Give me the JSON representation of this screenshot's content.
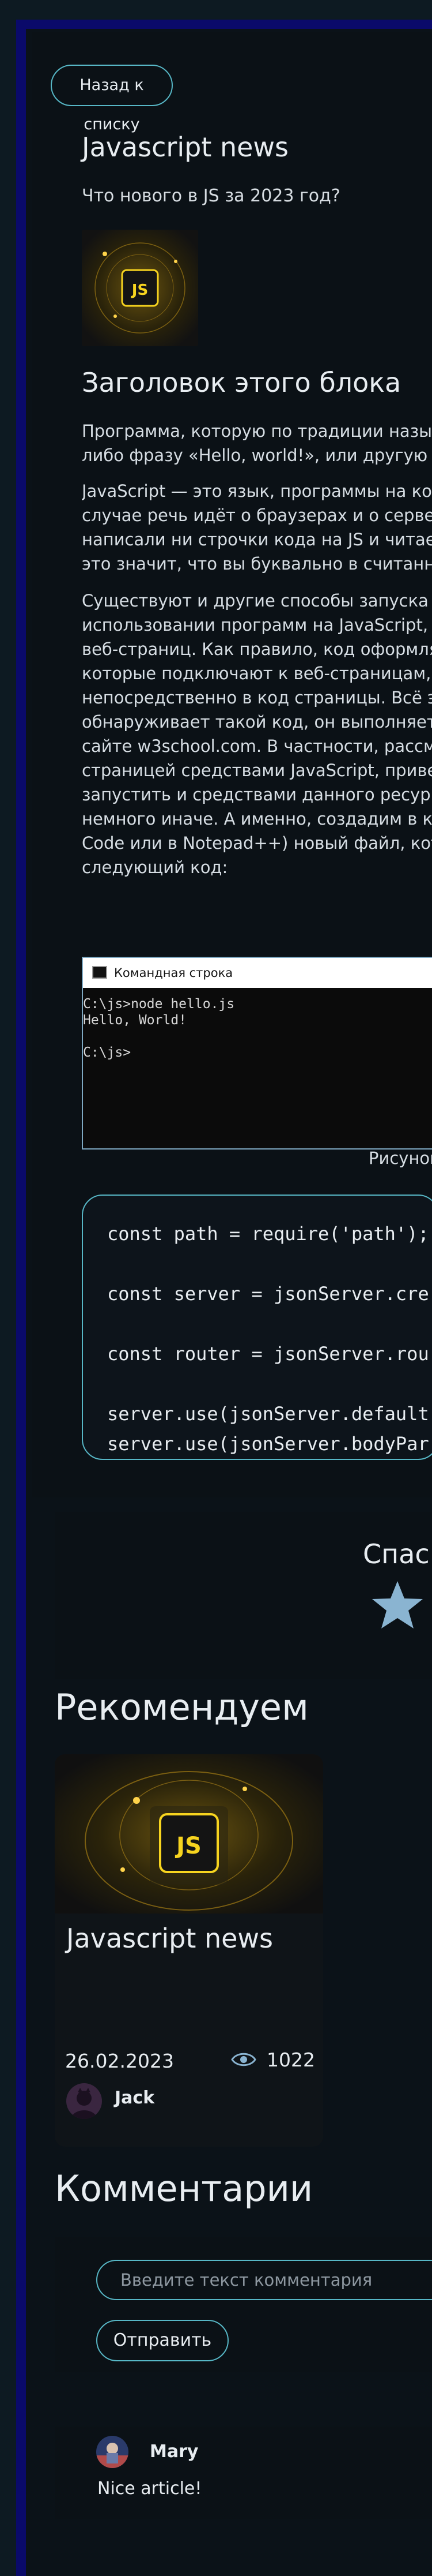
{
  "article": {
    "back_button": "Назад к списку",
    "title": "Javascript news",
    "subtitle": "Что нового в JS за 2023 год?",
    "thumbnail_icon": "js-logo-icon",
    "block_title": "Заголовок этого блока",
    "paragraphs": [
      [
        "Программа, которую по традиции назы",
        "либо фразу «Hello, world!», или другую п"
      ],
      [
        "JavaScript — это язык, программы на ко",
        "случае речь идёт о браузерах и о серве",
        "написали ни строчки кода на JS и читае",
        "это значит, что вы буквально в считанн"
      ],
      [
        "Существуют и другие способы запуска .",
        "использовании программ на JavaScript,",
        "веб-страниц. Как правило, код оформля",
        "которые подключают к веб-страницам,",
        "непосредственно в код страницы. Всё э",
        "обнаруживает такой код, он выполняет",
        "сайте w3school.com. В частности, рассм",
        "страницей средствами JavaScript, приве",
        "запустить и средствами данного ресур",
        "немного иначе. А именно, создадим в к",
        "Code или в Notepad++) новый файл, кот",
        "следующий код:"
      ]
    ],
    "console": {
      "window_title": "Командная строка",
      "lines": [
        "C:\\js>node hello.js",
        "Hello, World!",
        "",
        "C:\\js>"
      ]
    },
    "image_caption": "Рисунок",
    "code_lines": [
      "const path = require('path');",
      "",
      "const server = jsonServer.cre",
      "",
      "const router = jsonServer.rou",
      "",
      "server.use(jsonServer.default",
      "server.use(jsonServer.bodyPar"
    ]
  },
  "rating": {
    "title": "Спас",
    "star_icon": "star-icon"
  },
  "recommendations": {
    "section_title": "Рекомендуем",
    "items": [
      {
        "title": "Javascript news",
        "date": "26.02.2023",
        "views": "1022",
        "author": "Jack",
        "views_icon": "eye-icon"
      }
    ]
  },
  "comments": {
    "section_title": "Комментарии",
    "input_placeholder": "Введите текст комментария",
    "send_button": "Отправить",
    "items": [
      {
        "author": "Mary",
        "text": "Nice article!"
      }
    ]
  },
  "colors": {
    "accent": "#57b7c6",
    "background": "#0b0f14",
    "frame_blue": "#0a0a6a",
    "star": "#8ab4d1"
  }
}
